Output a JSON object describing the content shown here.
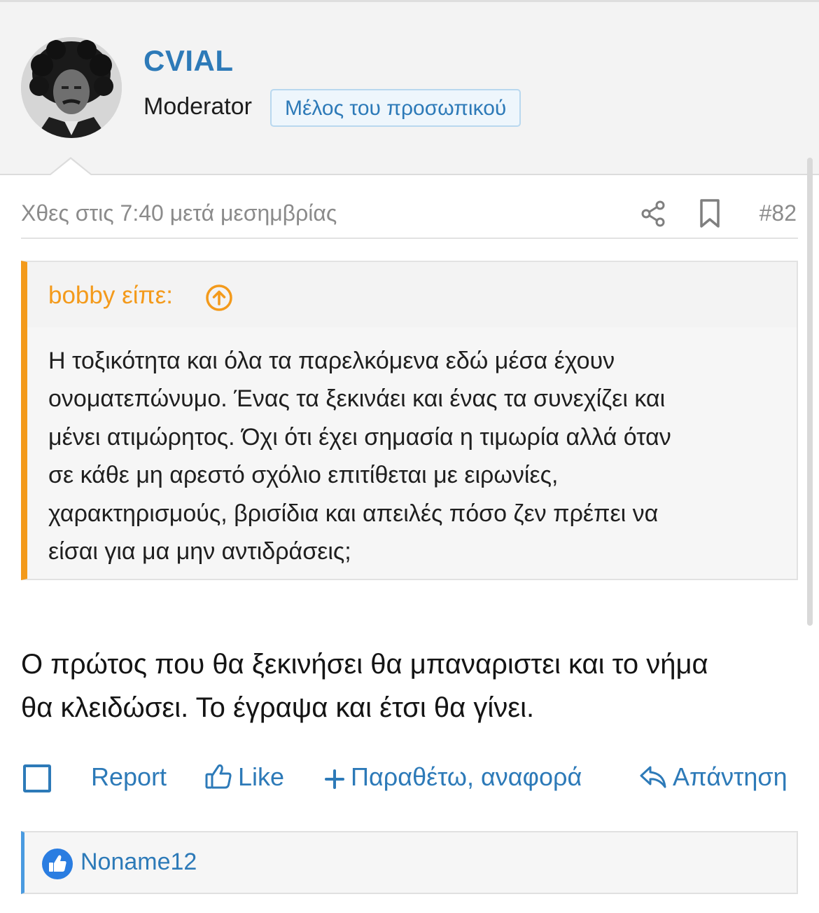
{
  "user": {
    "name": "CVIAL",
    "role": "Moderator",
    "badge": "Μέλος του προσωπικού"
  },
  "post": {
    "date": "Χθες στις 7:40 μετά μεσημβρίας",
    "number": "#82",
    "text_line1": "Ο πρώτος που θα ξεκινήσει θα μπαναριστει και το νήμα",
    "text_line2": "θα κλειδώσει. Το έγραψα και έτσι θα γίνει."
  },
  "quote": {
    "author_label": "bobby είπε:",
    "lines": [
      "Η τοξικότητα και όλα τα παρελκόμενα εδώ μέσα έχουν",
      "ονοματεπώνυμο. Ένας τα ξεκινάει και ένας τα συνεχίζει και",
      "μένει ατιμώρητος. Όχι ότι έχει σημασία η τιμωρία αλλά όταν",
      "σε κάθε μη αρεστό σχόλιο επιτίθεται με ειρωνίες,",
      "χαρακτηρισμούς, βρισίδια και απειλές πόσο ζεν πρέπει να",
      "είσαι για μα μην αντιδράσεις;"
    ]
  },
  "actions": {
    "report": "Report",
    "like": "Like",
    "quote": "Παραθέτω, αναφορά",
    "reply": "Απάντηση"
  },
  "reactions": {
    "users": "Noname12"
  },
  "colors": {
    "link_blue": "#2d7ab8",
    "quote_orange": "#f39a1b",
    "meta_gray": "#8b8b8b"
  },
  "icons": {
    "share": "share-icon",
    "bookmark": "bookmark-icon",
    "quote_jump": "arrow-up-circle-icon",
    "like": "thumbs-up-icon",
    "quote": "plus-icon",
    "reply": "reply-arrow-icon",
    "reaction": "like-reaction-icon"
  }
}
